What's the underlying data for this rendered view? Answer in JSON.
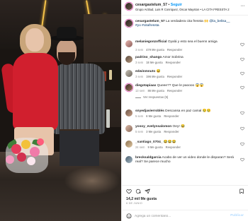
{
  "colors": {
    "accent": "#0095f6",
    "text": "#262626",
    "muted": "#8e8e8e",
    "link": "#00376b",
    "like_red": "#ed4956"
  },
  "media": {
    "description_icon": "post-photo"
  },
  "header": {
    "username": "cesargastelum_57",
    "separator": "•",
    "follow_label": "Seguir",
    "subtitle": "Grupo Actitud, Luis R Conriquez, Oscar Mayston • LA CITA FRESSTA 2",
    "more_icon": "more-horizontal-icon"
  },
  "caption": {
    "username": "cesargastelum_57",
    "text": "La verdadera cita fressta 🙌",
    "mention": "@la_belisa__",
    "mention_text": "#yo #citafressta"
  },
  "comments": [
    {
      "username": "melaniegonzofficial",
      "text": "Oyalá y esto sea el buenn amiga",
      "time": "3 sem",
      "likes": "479 Me gusta",
      "reply": "Responder"
    },
    {
      "username": "padrino_shango",
      "text": "Amor Sobrina",
      "time": "3 sem",
      "likes": "18 Me gusta",
      "reply": "Responder"
    },
    {
      "username": "edwinmnuto",
      "text": "😅",
      "time": "3 sem",
      "likes": "196 Me gusta",
      "reply": "Responder"
    },
    {
      "username": "diegotapiaax",
      "text": "Queee?? Que le paoooo 😱😱",
      "time": "13 sem",
      "likes": "86 Me gusta",
      "reply": "Responder",
      "view_replies": "Ver respuestas (5)"
    },
    {
      "username": "snyedjavierroblés",
      "text": "Descansa en paz camal 😢😢",
      "time": "5 sem",
      "likes": "6 Me gusta",
      "reply": "Responder"
    },
    {
      "username": "yosoy_evelynsalomon",
      "text": "Oey! 😂",
      "time": "5 sem",
      "likes": "3 Me gusta",
      "reply": "Responder"
    },
    {
      "username": "_santiago_0704_",
      "text": "😂😂😂",
      "time": "24 sem",
      "likes": "9 Me gusta",
      "reply": "Responder"
    },
    {
      "username": "brecksaldgarcia",
      "text": "Acabo de ver un video donde le disparan? Será real? Se parece mucho",
      "time": "",
      "likes": "",
      "reply": ""
    }
  ],
  "actions": {
    "like_icon": "heart-icon",
    "comment_icon": "comment-icon",
    "share_icon": "send-icon",
    "save_icon": "bookmark-icon"
  },
  "likes": "14,2 mil Me gusta",
  "date": "6 DE JUNIO",
  "composer": {
    "emoji_icon": "emoji-icon",
    "placeholder": "Agrega un comentario...",
    "publish_label": "Publicar"
  }
}
